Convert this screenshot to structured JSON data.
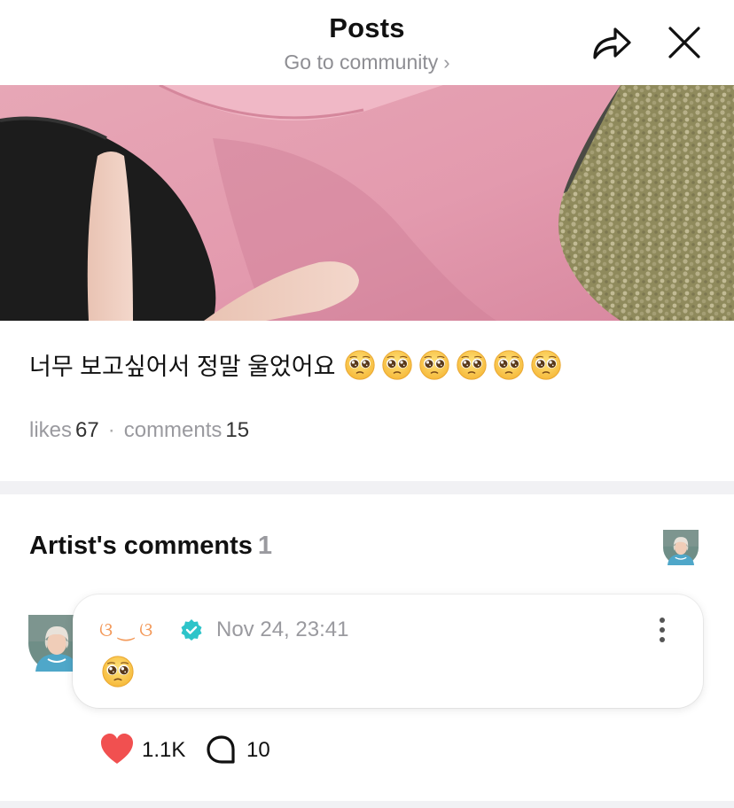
{
  "header": {
    "title": "Posts",
    "community_link": "Go to community",
    "share_icon": "share-icon",
    "close_icon": "close-icon"
  },
  "post": {
    "photo": "photo-of-pink-shirt-and-v-sign-hand",
    "text": "너무 보고싶어서 정말 울었어요",
    "emoji": "pleading-face-emoji",
    "emoji_count": 6,
    "likes_label": "likes",
    "likes_count": "67",
    "separator": "·",
    "comments_label": "comments",
    "comments_count": "15"
  },
  "artist_comments": {
    "title": "Artist's comments",
    "count": "1",
    "comment": {
      "author": "ଓ ‿ ଓ",
      "verified": true,
      "time": "Nov 24, 23:41",
      "emoji": "pleading-face-emoji",
      "like_count": "1.1K",
      "reply_count": "10"
    }
  },
  "colors": {
    "accent_orange": "#f39a5b",
    "verified_teal": "#2ec4c9",
    "heart_red": "#f15050",
    "muted_text": "#9a9a9f",
    "separator_band": "#f1f1f4"
  }
}
